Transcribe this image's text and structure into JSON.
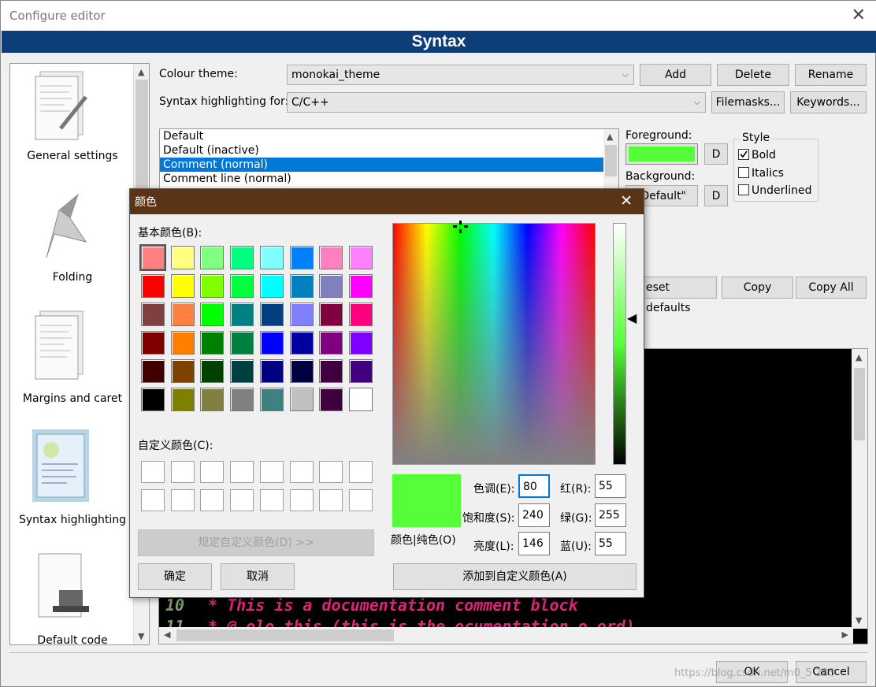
{
  "window": {
    "title": "Configure editor",
    "banner": "Syntax"
  },
  "sidebar": {
    "items": [
      {
        "label": "General settings"
      },
      {
        "label": "Folding"
      },
      {
        "label": "Margins and caret"
      },
      {
        "label": "Syntax highlighting"
      },
      {
        "label": "Default code"
      }
    ]
  },
  "theme": {
    "label": "Colour theme:",
    "value": "monokai_theme",
    "add": "Add",
    "delete": "Delete",
    "rename": "Rename"
  },
  "highlight": {
    "label": "Syntax highlighting for:",
    "value": "C/C++",
    "filemasks": "Filemasks...",
    "keywords": "Keywords..."
  },
  "styles": {
    "items": [
      "Default",
      "Default (inactive)",
      "Comment (normal)",
      "Comment line (normal)"
    ],
    "selected_index": 2
  },
  "foreground": {
    "label": "Foreground:",
    "color": "#55ff37",
    "d": "D"
  },
  "background": {
    "label": "Background:",
    "value": "Default\"",
    "d": "D"
  },
  "style": {
    "label": "Style",
    "bold": "Bold",
    "italics": "Italics",
    "underlined": "Underlined",
    "bold_checked": true
  },
  "actions": {
    "reset": "eset defaults",
    "copy": "Copy",
    "copy_all": "Copy All"
  },
  "editor": {
    "line_number": "10",
    "line_text": "* This is a documentation comment block",
    "line2": "* @              olo  this (this is the  ocumentation  o  ord)",
    "line2_number": "11"
  },
  "footer": {
    "ok": "OK",
    "cancel": "Cancel",
    "watermark": "https://blog.csdn.net/m0_5       283"
  },
  "color_dialog": {
    "title": "颜色",
    "basic_label": "基本颜色(B):",
    "custom_label": "自定义颜色(C):",
    "define_custom": "规定自定义颜色(D) >>",
    "ok": "确定",
    "cancel": "取消",
    "solid_label": "颜色|纯色(O)",
    "hue_label": "色调(E):",
    "hue": "80",
    "sat_label": "饱和度(S):",
    "sat": "240",
    "lum_label": "亮度(L):",
    "lum": "146",
    "red_label": "红(R):",
    "red": "55",
    "green_label": "绿(G):",
    "green": "255",
    "blue_label": "蓝(U):",
    "blue": "55",
    "add_custom": "添加到自定义颜色(A)",
    "current_color": "#55ff37",
    "basic_colors": [
      "#ff8080",
      "#ffff80",
      "#80ff80",
      "#00ff80",
      "#80ffff",
      "#0080ff",
      "#ff80c0",
      "#ff80ff",
      "#ff0000",
      "#ffff00",
      "#80ff00",
      "#00ff40",
      "#00ffff",
      "#0080c0",
      "#8080c0",
      "#ff00ff",
      "#804040",
      "#ff8040",
      "#00ff00",
      "#008080",
      "#004080",
      "#8080ff",
      "#800040",
      "#ff0080",
      "#800000",
      "#ff8000",
      "#008000",
      "#008040",
      "#0000ff",
      "#0000a0",
      "#800080",
      "#8000ff",
      "#400000",
      "#804000",
      "#004000",
      "#004040",
      "#000080",
      "#000040",
      "#400040",
      "#400080",
      "#000000",
      "#808000",
      "#808040",
      "#808080",
      "#408080",
      "#c0c0c0",
      "#400040",
      "#ffffff"
    ]
  }
}
